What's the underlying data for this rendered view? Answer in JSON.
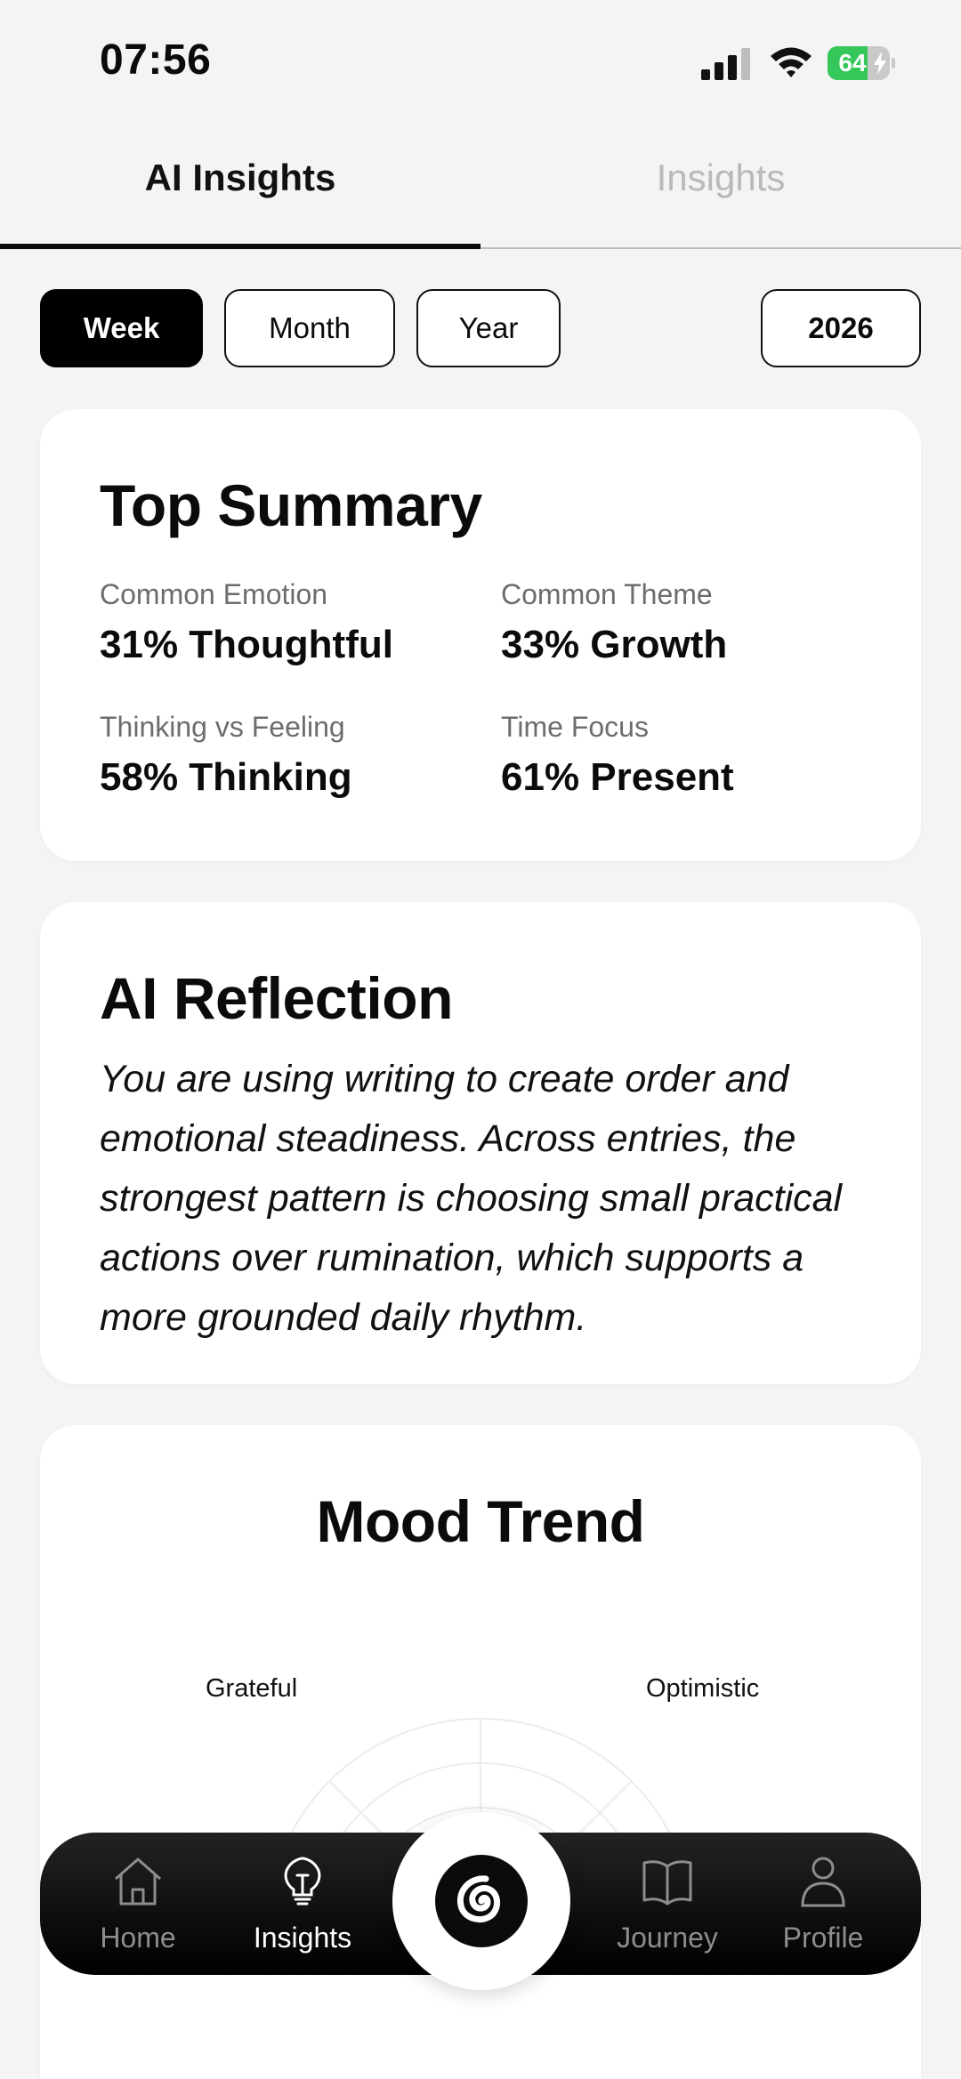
{
  "status_bar": {
    "time": "07:56",
    "battery_percent": 64,
    "battery_label": "64",
    "battery_color": "#34c759",
    "icons": [
      "signal-icon",
      "wifi-icon",
      "battery-charging-icon"
    ]
  },
  "tabs": [
    {
      "label": "AI Insights",
      "active": true
    },
    {
      "label": "Insights",
      "active": false
    }
  ],
  "period_filter": {
    "options": [
      "Week",
      "Month",
      "Year"
    ],
    "selected": "Week",
    "year": "2026"
  },
  "summary": {
    "title": "Top Summary",
    "stats": [
      {
        "label": "Common Emotion",
        "value": "31% Thoughtful"
      },
      {
        "label": "Common Theme",
        "value": "33% Growth"
      },
      {
        "label": "Thinking vs Feeling",
        "value": "58% Thinking"
      },
      {
        "label": "Time Focus",
        "value": "61% Present"
      }
    ]
  },
  "reflection": {
    "title": "AI Reflection",
    "text": "You are using writing to create order and emotional steadiness. Across entries, the strongest pattern is choosing small practical actions over rumination, which supports a more grounded daily rhythm."
  },
  "mood_trend": {
    "title": "Mood Trend",
    "axis_labels": [
      "Grateful",
      "Optimistic"
    ]
  },
  "bottom_nav": {
    "items": [
      {
        "label": "Home",
        "icon": "home-icon",
        "active": false
      },
      {
        "label": "Insights",
        "icon": "lightbulb-icon",
        "active": true
      },
      {
        "label": "Journey",
        "icon": "book-icon",
        "active": false
      },
      {
        "label": "Profile",
        "icon": "person-icon",
        "active": false
      }
    ],
    "center_icon": "spiral-icon"
  },
  "colors": {
    "background": "#f4f4f4",
    "card": "#ffffff",
    "accent": "#000000",
    "muted_text": "#6d6d6d",
    "inactive_tab": "#b9b9b9"
  }
}
